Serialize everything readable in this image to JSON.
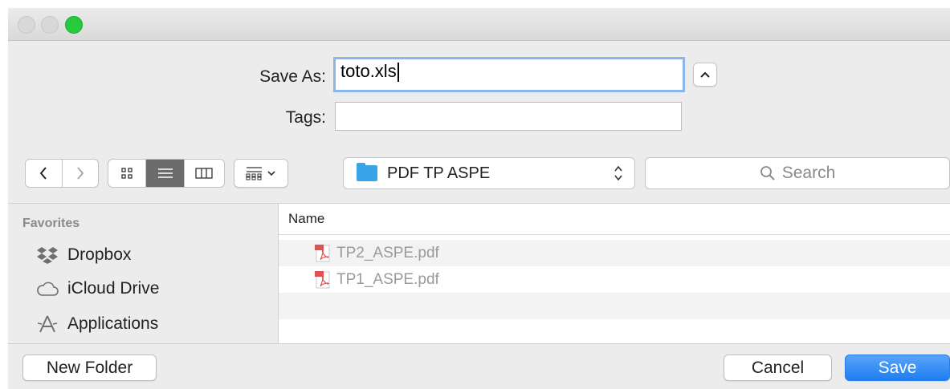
{
  "save_row": {
    "label": "Save As:",
    "value": "toto.xls"
  },
  "tags_row": {
    "label": "Tags:",
    "value": ""
  },
  "location": {
    "folder": "PDF TP ASPE"
  },
  "search": {
    "placeholder": "Search"
  },
  "sidebar": {
    "heading": "Favorites",
    "items": [
      {
        "label": "Dropbox",
        "icon": "dropbox-icon"
      },
      {
        "label": "iCloud Drive",
        "icon": "cloud-icon"
      },
      {
        "label": "Applications",
        "icon": "applications-icon"
      }
    ]
  },
  "list": {
    "column": "Name",
    "files": [
      {
        "name": "TP2_ASPE.pdf"
      },
      {
        "name": "TP1_ASPE.pdf"
      }
    ]
  },
  "footer": {
    "new_folder": "New Folder",
    "cancel": "Cancel",
    "save": "Save"
  },
  "colors": {
    "accent": "#1d7ef0",
    "focus_ring": "#8cb5ee",
    "folder": "#3aa4e8",
    "zoom_light": "#27c93f"
  }
}
